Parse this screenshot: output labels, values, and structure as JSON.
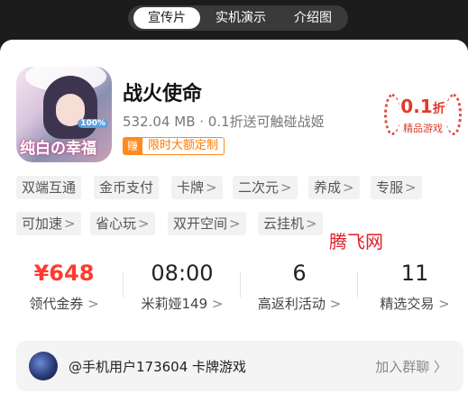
{
  "tabs": [
    {
      "label": "宣传片",
      "active": true
    },
    {
      "label": "实机演示",
      "active": false
    },
    {
      "label": "介绍图",
      "active": false
    }
  ],
  "game": {
    "icon_text": "纯白の幸福",
    "icon_badge": "100%",
    "title": "战火使命",
    "subtitle": "532.04 MB · 0.1折送可触碰战姬",
    "promo_badge": "赚",
    "promo_text": "限时大额定制"
  },
  "discount": {
    "value": "0.1",
    "unit": "折",
    "label": "精品游戏"
  },
  "tags": [
    {
      "label": "双端互通",
      "arrow": ""
    },
    {
      "label": "金币支付",
      "arrow": ""
    },
    {
      "label": "卡牌",
      "arrow": ">"
    },
    {
      "label": "二次元",
      "arrow": ">"
    },
    {
      "label": "养成",
      "arrow": ">"
    },
    {
      "label": "专服",
      "arrow": ">"
    },
    {
      "label": "可加速",
      "arrow": ">"
    },
    {
      "label": "省心玩",
      "arrow": ">"
    },
    {
      "label": "双开空间",
      "arrow": ">"
    },
    {
      "label": "云挂机",
      "arrow": ">"
    }
  ],
  "watermark": "腾飞网",
  "stats": [
    {
      "value": "¥648",
      "label": "领代金券",
      "arrow": ">"
    },
    {
      "value": "08:00",
      "label": "米莉娅149",
      "arrow": ">"
    },
    {
      "value": "6",
      "label": "高返利活动",
      "arrow": ">"
    },
    {
      "value": "11",
      "label": "精选交易",
      "arrow": ">"
    }
  ],
  "group": {
    "text": "@手机用户173604 卡牌游戏",
    "join": "加入群聊 〉"
  },
  "colors": {
    "accent_red": "#ff3b30",
    "promo_orange": "#ff8a1f",
    "background_dark": "#1c1c1c"
  }
}
